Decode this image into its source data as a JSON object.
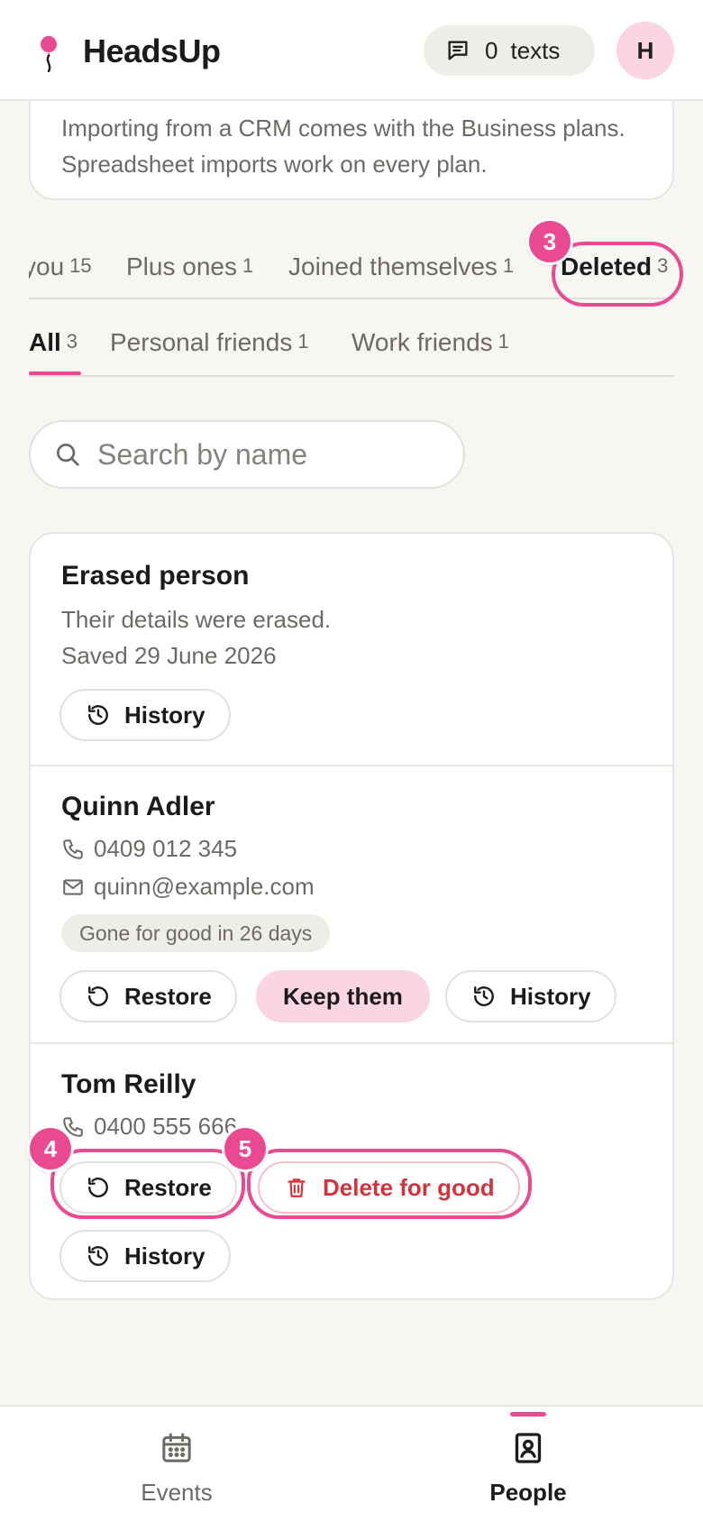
{
  "app": {
    "name": "HeadsUp",
    "brand_color": "#ea4a91"
  },
  "header": {
    "texts_count": "0",
    "texts_label": "texts",
    "avatar_initial": "H"
  },
  "info_card": {
    "text": "Importing from a CRM comes with the Business plans. Spreadsheet imports work on every plan."
  },
  "status_tabs": [
    {
      "label": "you",
      "count": "15"
    },
    {
      "label": "Plus ones",
      "count": "1"
    },
    {
      "label": "Joined themselves",
      "count": "1"
    },
    {
      "label": "Deleted",
      "count": "3",
      "active": true
    }
  ],
  "group_tabs": [
    {
      "label": "All",
      "count": "3",
      "active": true
    },
    {
      "label": "Personal friends",
      "count": "1"
    },
    {
      "label": "Work friends",
      "count": "1"
    }
  ],
  "search": {
    "placeholder": "Search by name",
    "value": ""
  },
  "people": [
    {
      "name": "Erased person",
      "detail": "Their details were erased.",
      "saved": "Saved 29 June 2026",
      "buttons": {
        "history": "History"
      }
    },
    {
      "name": "Quinn Adler",
      "phone": "0409 012 345",
      "email": "quinn@example.com",
      "badge": "Gone for good in 26 days",
      "buttons": {
        "restore": "Restore",
        "keep": "Keep them",
        "history": "History"
      }
    },
    {
      "name": "Tom Reilly",
      "phone": "0400 555 666",
      "buttons": {
        "restore": "Restore",
        "delete": "Delete for good",
        "history": "History"
      }
    }
  ],
  "annotations": [
    "3",
    "4",
    "5"
  ],
  "bottom_nav": [
    {
      "label": "Events",
      "icon": "calendar-icon"
    },
    {
      "label": "People",
      "icon": "contact-book-icon",
      "active": true
    }
  ]
}
